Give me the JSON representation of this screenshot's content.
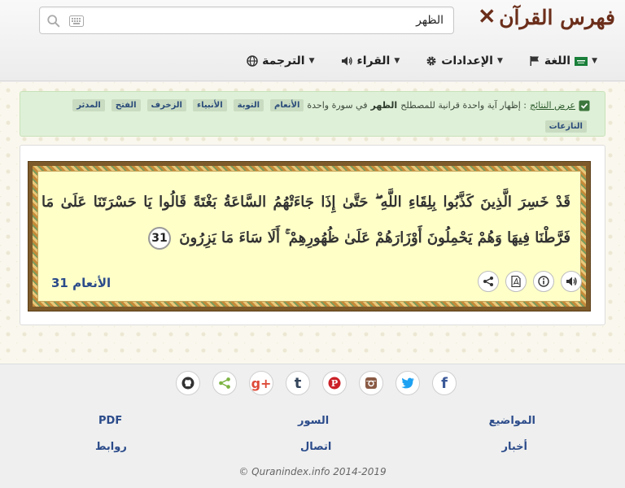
{
  "header": {
    "logo_text": "فهرس القرآن",
    "search": {
      "value": "الظهر",
      "placeholder": ""
    },
    "menu": [
      {
        "label": "الترجمة",
        "icon": "globe-icon"
      },
      {
        "label": "القراء",
        "icon": "speaker-icon"
      },
      {
        "label": "الإعدادات",
        "icon": "gear-icon"
      },
      {
        "label": "اللغة",
        "icon": "flag-icon"
      }
    ]
  },
  "alert": {
    "link_text": "عرض النتائج",
    "text_before": ": إظهار آية واحدة قرانية للمصطلح",
    "term": "الظهر",
    "text_after": "في سورة واحدة",
    "tags": [
      "الأنعام",
      "التوبة",
      "الأنبياء",
      "الزخرف",
      "الفتح",
      "المدثر",
      "النازعات"
    ]
  },
  "verse": {
    "text": "قَدْ خَسِرَ الَّذِينَ كَذَّبُوا بِلِقَاءِ اللَّهِ ۖ حَتَّىٰ إِذَا جَاءَتْهُمُ السَّاعَةُ بَغْتَةً قَالُوا يَا حَسْرَتَنَا عَلَىٰ مَا فَرَّطْنَا فِيهَا وَهُمْ يَحْمِلُونَ أَوْزَارَهُمْ عَلَىٰ ظُهُورِهِمْ ۚ أَلَا سَاءَ مَا يَزِرُونَ",
    "number": "31",
    "sura_ref": "الأنعام 31",
    "actions": [
      "share-icon",
      "pdf-icon",
      "info-icon",
      "audio-icon"
    ]
  },
  "footer": {
    "social": [
      {
        "name": "github",
        "glyph": "",
        "color": "#333333"
      },
      {
        "name": "share",
        "glyph": "",
        "color": "#7cb342"
      },
      {
        "name": "google-plus",
        "glyph": "g+",
        "color": "#dd4b39"
      },
      {
        "name": "tumblr",
        "glyph": "t",
        "color": "#35465c"
      },
      {
        "name": "pinterest",
        "glyph": "P",
        "color": "#cb2027"
      },
      {
        "name": "instagram",
        "glyph": "",
        "color": "#8a5a44"
      },
      {
        "name": "twitter",
        "glyph": "",
        "color": "#1da1f2"
      },
      {
        "name": "facebook",
        "glyph": "f",
        "color": "#3b5998"
      }
    ],
    "links": {
      "topics": "المواضيع",
      "suras": "السور",
      "pdf": "PDF",
      "news": "أخبار",
      "contact": "اتصال",
      "links": "روابط"
    },
    "copyright": "© Quranindex.info 2014-2019"
  }
}
